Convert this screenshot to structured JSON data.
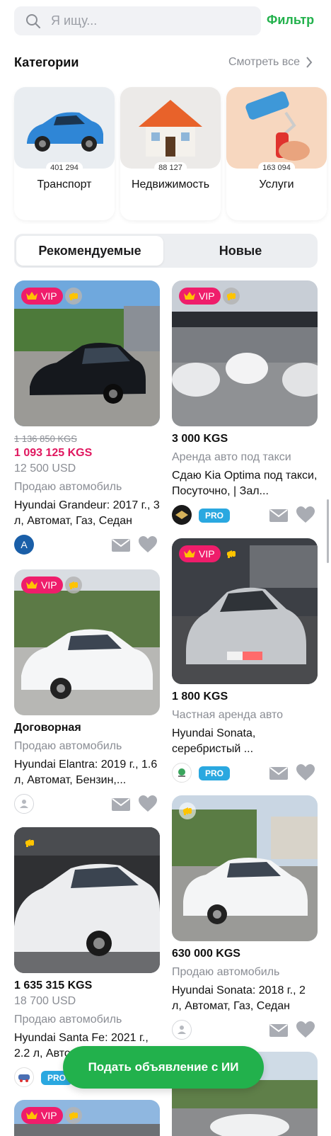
{
  "search": {
    "placeholder": "Я ищу...",
    "filter_label": "Фильтр"
  },
  "categories": {
    "title": "Категории",
    "see_all": "Смотреть все",
    "items": [
      {
        "label": "Транспорт",
        "count": "401 294"
      },
      {
        "label": "Недвижимость",
        "count": "88 127"
      },
      {
        "label": "Услуги",
        "count": "163 094"
      }
    ]
  },
  "tabs": [
    {
      "label": "Рекомендуемые",
      "active": true
    },
    {
      "label": "Новые",
      "active": false
    }
  ],
  "badges": {
    "vip": "VIP",
    "pro": "PRO"
  },
  "listings": [
    {
      "old_price": "1 136 850 KGS",
      "price": "1 093 125 KGS",
      "usd": "12 500 USD",
      "category": "Продаю автомобиль",
      "title": "Hyundai Grandeur: 2017 г., 3 л, Автомат, Газ, Седан",
      "avatar_letter": "A",
      "vip": true
    },
    {
      "price": "3 000 KGS",
      "category": "Аренда авто под такси",
      "title": "Сдаю Kia Optima под такси, Посуточно, | Зал...",
      "vip": true,
      "pro": true
    },
    {
      "price": "Договорная",
      "category": "Продаю автомобиль",
      "title": "Hyundai Elantra: 2019 г., 1.6 л, Автомат, Бензин,...",
      "vip": true
    },
    {
      "price": "1 800 KGS",
      "category": "Частная аренда авто",
      "title": "Hyundai Sonata, серебристый ...",
      "vip": true,
      "pro": true
    },
    {
      "price": "630 000 KGS",
      "category": "Продаю автомобиль",
      "title": "Hyundai Sonata: 2018 г., 2 л, Автомат, Газ, Седан"
    },
    {
      "price": "1 635 315 KGS",
      "usd": "18 700 USD",
      "category": "Продаю автомобиль",
      "title": "Hyundai Santa Fe: 2021 г., 2.2 л, Автомат, Дизель",
      "pro": true
    }
  ],
  "cta": {
    "label": "Подать объявление с ИИ"
  },
  "colors": {
    "accent": "#22b14c",
    "vip": "#ef1d6b",
    "price_red": "#e0175f",
    "pro": "#2aa8e0"
  }
}
